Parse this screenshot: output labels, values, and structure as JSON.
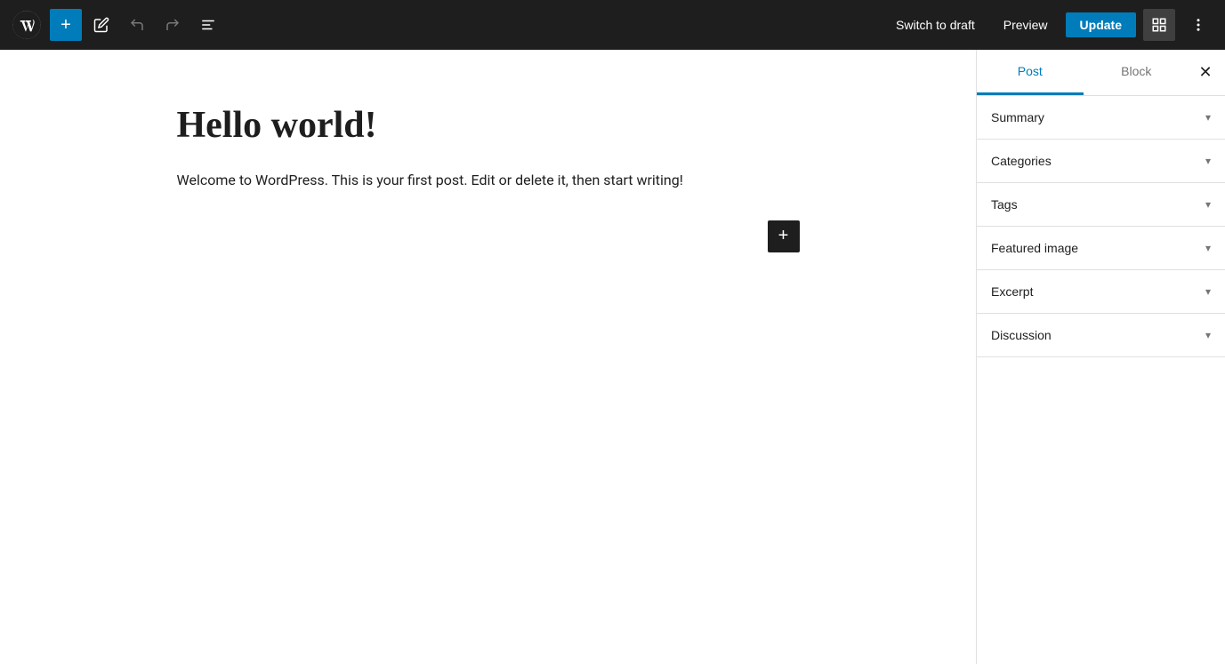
{
  "toolbar": {
    "add_label": "+",
    "switch_to_draft_label": "Switch to draft",
    "preview_label": "Preview",
    "update_label": "Update"
  },
  "sidebar": {
    "tabs": [
      {
        "id": "post",
        "label": "Post",
        "active": true
      },
      {
        "id": "block",
        "label": "Block",
        "active": false
      }
    ],
    "sections": [
      {
        "id": "summary",
        "label": "Summary"
      },
      {
        "id": "categories",
        "label": "Categories"
      },
      {
        "id": "tags",
        "label": "Tags"
      },
      {
        "id": "featured-image",
        "label": "Featured image"
      },
      {
        "id": "excerpt",
        "label": "Excerpt"
      },
      {
        "id": "discussion",
        "label": "Discussion"
      }
    ]
  },
  "editor": {
    "title": "Hello world!",
    "body": "Welcome to WordPress. This is your first post. Edit or delete it, then start writing!"
  }
}
